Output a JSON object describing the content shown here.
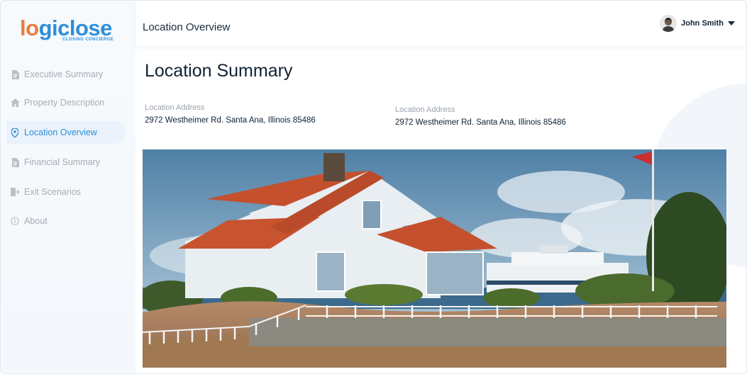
{
  "brand": {
    "logo_text_orange": "lo",
    "logo_text_blue": "giclose",
    "tagline": "CLOSING CONCIERGE"
  },
  "sidebar": {
    "items": [
      {
        "label": "Executive Summary",
        "icon": "document-icon",
        "active": false
      },
      {
        "label": "Property Description",
        "icon": "home-icon",
        "active": false
      },
      {
        "label": "Location Overview",
        "icon": "location-pin-icon",
        "active": true
      },
      {
        "label": "Financial Summary",
        "icon": "document-icon",
        "active": false
      },
      {
        "label": "Exit Scenarios",
        "icon": "exit-icon",
        "active": false
      },
      {
        "label": "About",
        "icon": "info-icon",
        "active": false
      }
    ]
  },
  "header": {
    "title": "Location Overview"
  },
  "user": {
    "name": "John Smith"
  },
  "main": {
    "title": "Location Summary",
    "address_1": {
      "label": "Location Address",
      "value": "2972 Westheimer Rd. Santa Ana, Illinois 85486"
    },
    "address_2": {
      "label": "Location Address",
      "value": "2972 Westheimer Rd. Santa Ana, Illinois 85486"
    }
  },
  "colors": {
    "accent": "#2f8fd8",
    "brand_orange": "#f07a3a",
    "active_bg": "#eaf2fb",
    "muted": "#a5adb6"
  }
}
